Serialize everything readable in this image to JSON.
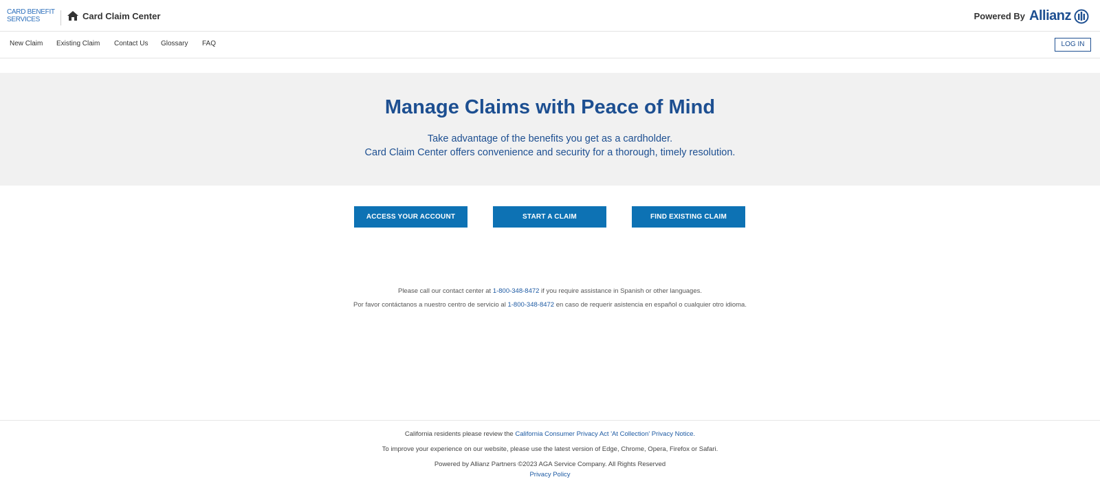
{
  "header": {
    "logo_line1": "CARD BENEFIT",
    "logo_line2": "SERVICES",
    "app_title": "Card Claim Center",
    "powered_by": "Powered By",
    "brand": "Allianz"
  },
  "nav": {
    "items": [
      "New Claim",
      "Existing Claim",
      "Contact Us",
      "Glossary",
      "FAQ"
    ],
    "login": "LOG IN"
  },
  "hero": {
    "title": "Manage Claims with Peace of Mind",
    "line1": "Take advantage of the benefits you get as a cardholder.",
    "line2": "Card Claim Center offers convenience and security for a thorough, timely resolution."
  },
  "actions": {
    "access": "ACCESS YOUR ACCOUNT",
    "start": "START A CLAIM",
    "find": "FIND EXISTING CLAIM"
  },
  "contact": {
    "en_before": "Please call our contact center at ",
    "phone": "1-800-348-8472",
    "en_after": " if you require assistance in Spanish or other languages.",
    "es_before": "Por favor contáctanos a nuestro centro de servicio al ",
    "es_after": " en caso de requerir asistencia en español o cualquier otro idioma."
  },
  "footer": {
    "ca_before": "California residents please review the ",
    "ca_link": "California Consumer Privacy Act 'At Collection' Privacy Notice.",
    "browsers": "To improve your experience on our website, please use the latest version of Edge, Chrome, Opera, Firefox or Safari.",
    "copyright": "Powered by Allianz Partners ©2023 AGA Service Company. All Rights Reserved",
    "privacy": "Privacy Policy"
  },
  "colors": {
    "brand_blue": "#1d4f91",
    "button_blue": "#0d72b4",
    "hero_bg": "#f1f1f1"
  }
}
